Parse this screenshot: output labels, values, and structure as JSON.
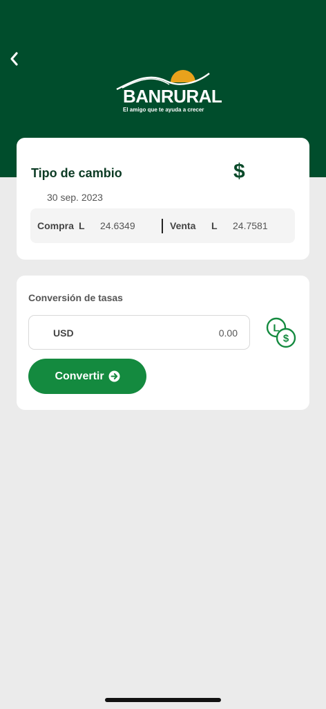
{
  "header": {
    "back_icon": "chevron-left-icon",
    "brand": "BANRURAL",
    "tagline": "El amigo que te ayuda a crecer",
    "colors": {
      "background": "#004d2c",
      "sun": "#e8a21c"
    }
  },
  "exchange_rate": {
    "title": "Tipo de cambio",
    "icon": "dollar-sign-icon",
    "date": "30 sep. 2023",
    "buy_label": "Compra",
    "buy_currency": "L",
    "buy_value": "24.6349",
    "sell_label": "Venta",
    "sell_currency": "L",
    "sell_value": "24.7581"
  },
  "conversion": {
    "title": "Conversión de tasas",
    "currency": "USD",
    "amount": "0.00",
    "swap_icon": "currency-swap-icon",
    "button_label": "Convertir",
    "button_icon": "arrow-right-circle-icon",
    "colors": {
      "button": "#148a3f",
      "accent": "#148a3f"
    }
  }
}
